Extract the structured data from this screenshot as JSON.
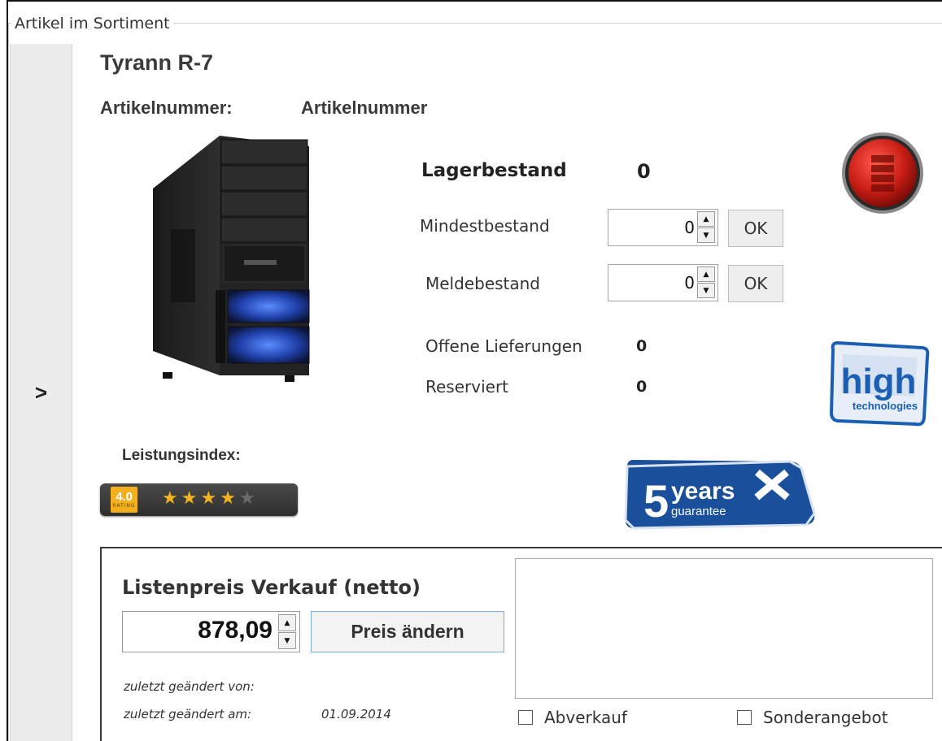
{
  "section": {
    "legend": "Artikel im Sortiment"
  },
  "sidebar": {
    "toggle_label": ">"
  },
  "product": {
    "title": "Tyrann R-7",
    "artikelnummer_label": "Artikelnummer:",
    "artikelnummer_value": "Artikelnummer",
    "image_icon": "pc-tower-image"
  },
  "stock": {
    "lagerbestand_label": "Lagerbestand",
    "lagerbestand_value": "0",
    "mindestbestand_label": "Mindestbestand",
    "mindestbestand_value": "0",
    "meldebestand_label": "Meldebestand",
    "meldebestand_value": "0",
    "ok_label": "OK",
    "offene_label": "Offene Lieferungen",
    "offene_value": "0",
    "reserviert_label": "Reserviert",
    "reserviert_value": "0"
  },
  "badges": {
    "stop_icon": "red-stop-icon",
    "high_main": "high",
    "high_sub": "technologies",
    "years_num": "5",
    "years_word": "years",
    "years_sub": "guarantee"
  },
  "rating": {
    "label": "Leistungsindex:",
    "score": "4.0",
    "caption": "RATING",
    "stars_filled": 4,
    "stars_total": 5
  },
  "price": {
    "title": "Listenpreis Verkauf (netto)",
    "value": "878,09",
    "change_button": "Preis ändern",
    "changed_by_label": "zuletzt geändert von:",
    "changed_at_label": "zuletzt geändert am:",
    "changed_at_value": "01.09.2014",
    "checkbox_abverkauf": "Abverkauf",
    "checkbox_sonderangebot": "Sonderangebot"
  },
  "colors": {
    "accent_blue": "#1a5fb4",
    "rating_gold": "#f2b01e",
    "stop_red": "#d0201a"
  }
}
